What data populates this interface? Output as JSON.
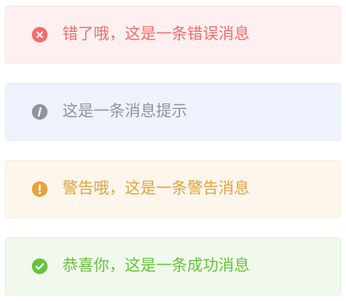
{
  "alerts": [
    {
      "type": "error",
      "icon": "error-circle-icon",
      "message": "错了哦，这是一条错误消息",
      "color": "#f56c6c",
      "background": "#fef0f0"
    },
    {
      "type": "info",
      "icon": "info-circle-icon",
      "message": "这是一条消息提示",
      "color": "#909399",
      "background": "#edf2fc"
    },
    {
      "type": "warning",
      "icon": "warning-circle-icon",
      "message": "警告哦，这是一条警告消息",
      "color": "#e6a23c",
      "background": "#fdf6ec"
    },
    {
      "type": "success",
      "icon": "success-check-circle-icon",
      "message": "恭喜你，这是一条成功消息",
      "color": "#67c23a",
      "background": "#f0f9eb"
    }
  ]
}
